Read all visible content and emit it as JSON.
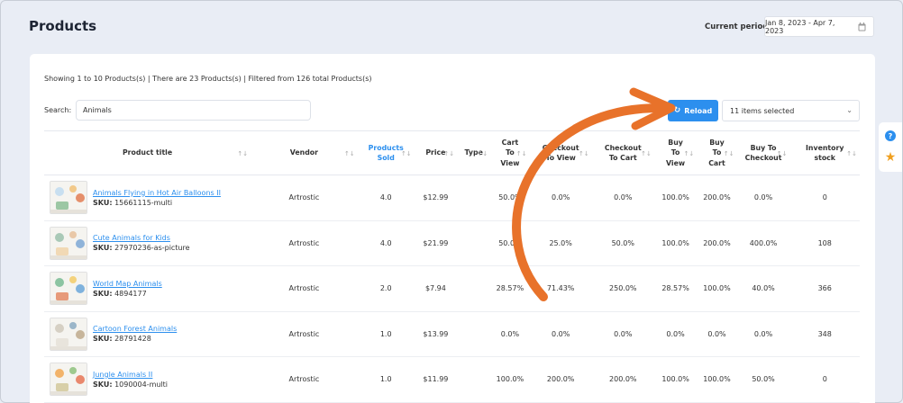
{
  "page": {
    "title": "Products"
  },
  "period": {
    "label": "Current period:",
    "value": "Jan 8, 2023 - Apr 7, 2023",
    "icon": "calendar-icon"
  },
  "summary": "Showing 1 to 10 Products(s) | There are 23 Products(s) | Filtered from 126 total Products(s)",
  "search": {
    "label": "Search:",
    "value": "Animals"
  },
  "toolbar": {
    "reload_label": "Reload",
    "reload_icon": "refresh-icon",
    "items_selected": "11 items selected"
  },
  "colors": {
    "accent": "#2c8fee",
    "arrow": "#e8722a",
    "background": "#e9edf5"
  },
  "table": {
    "headers": [
      {
        "key": "title",
        "lines": [
          "Product title"
        ]
      },
      {
        "key": "vendor",
        "lines": [
          "Vendor"
        ]
      },
      {
        "key": "sold",
        "lines": [
          "Products",
          "Sold"
        ],
        "active": true
      },
      {
        "key": "price",
        "lines": [
          "Price"
        ]
      },
      {
        "key": "type",
        "lines": [
          "Type"
        ]
      },
      {
        "key": "c2v",
        "lines": [
          "Cart",
          "To",
          "View"
        ]
      },
      {
        "key": "ch2v",
        "lines": [
          "Checkout",
          "To View"
        ]
      },
      {
        "key": "ch2c",
        "lines": [
          "Checkout",
          "To Cart"
        ]
      },
      {
        "key": "b2v",
        "lines": [
          "Buy",
          "To",
          "View"
        ]
      },
      {
        "key": "b2c",
        "lines": [
          "Buy",
          "To",
          "Cart"
        ]
      },
      {
        "key": "b2ch",
        "lines": [
          "Buy To",
          "Checkout"
        ]
      },
      {
        "key": "stock",
        "lines": [
          "Inventory",
          "stock"
        ]
      }
    ],
    "rows": [
      {
        "name": "Animals Flying in Hot Air Balloons II",
        "sku_label": "SKU:",
        "sku": "15661115-multi",
        "vendor": "Artrostic",
        "sold": "4.0",
        "price": "$12.99",
        "type": "",
        "c2v": "50.0%",
        "ch2v": "0.0%",
        "ch2c": "0.0%",
        "b2v": "100.0%",
        "b2c": "200.0%",
        "b2ch": "0.0%",
        "stock": "0"
      },
      {
        "name": "Cute Animals for Kids",
        "sku_label": "SKU:",
        "sku": "27970236-as-picture",
        "vendor": "Artrostic",
        "sold": "4.0",
        "price": "$21.99",
        "type": "",
        "c2v": "50.0%",
        "ch2v": "25.0%",
        "ch2c": "50.0%",
        "b2v": "100.0%",
        "b2c": "200.0%",
        "b2ch": "400.0%",
        "stock": "108"
      },
      {
        "name": "World Map Animals",
        "sku_label": "SKU:",
        "sku": "4894177",
        "vendor": "Artrostic",
        "sold": "2.0",
        "price": "$7.94",
        "type": "",
        "c2v": "28.57%",
        "ch2v": "71.43%",
        "ch2c": "250.0%",
        "b2v": "28.57%",
        "b2c": "100.0%",
        "b2ch": "40.0%",
        "stock": "366"
      },
      {
        "name": "Cartoon Forest Animals",
        "sku_label": "SKU:",
        "sku": "28791428",
        "vendor": "Artrostic",
        "sold": "1.0",
        "price": "$13.99",
        "type": "",
        "c2v": "0.0%",
        "ch2v": "0.0%",
        "ch2c": "0.0%",
        "b2v": "0.0%",
        "b2c": "0.0%",
        "b2ch": "0.0%",
        "stock": "348"
      },
      {
        "name": "Jungle Animals II",
        "sku_label": "SKU:",
        "sku": "1090004-multi",
        "vendor": "Artrostic",
        "sold": "1.0",
        "price": "$11.99",
        "type": "",
        "c2v": "100.0%",
        "ch2v": "200.0%",
        "ch2c": "200.0%",
        "b2v": "100.0%",
        "b2c": "100.0%",
        "b2ch": "50.0%",
        "stock": "0"
      }
    ]
  },
  "side_tab": {
    "icons": [
      "help-icon",
      "star-icon"
    ]
  }
}
